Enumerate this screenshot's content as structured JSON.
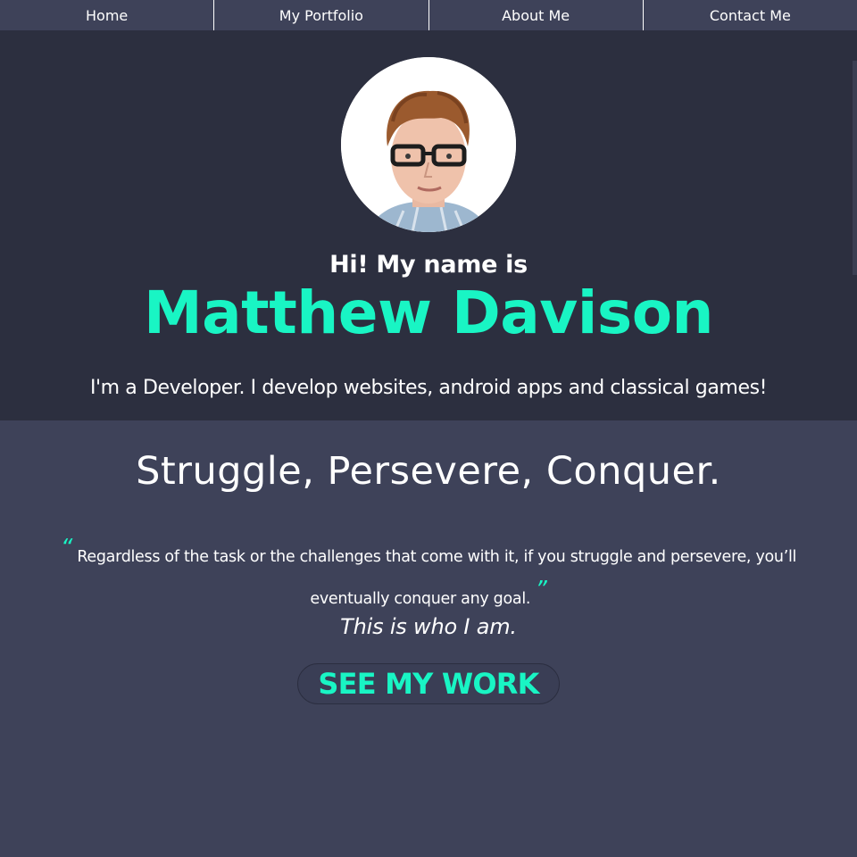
{
  "nav": {
    "items": [
      {
        "label": "Home"
      },
      {
        "label": "My Portfolio"
      },
      {
        "label": "About Me"
      },
      {
        "label": "Contact Me"
      }
    ]
  },
  "hero": {
    "greeting": "Hi! My name is",
    "name": "Matthew Davison",
    "tagline": "I'm a Developer. I develop websites, android apps and classical games!"
  },
  "about": {
    "motto": "Struggle, Persevere, Conquer.",
    "quote_open": "“",
    "quote": "Regardless of the task or the challenges that come with it, if you struggle and persevere, you’ll eventually conquer any goal.",
    "quote_close": "”",
    "identity": "This is who I am.",
    "cta_label": "SEE MY WORK"
  },
  "colors": {
    "accent": "#19f5c4",
    "hero_bg": "#2c2f3f",
    "page_bg": "#3e4259"
  }
}
